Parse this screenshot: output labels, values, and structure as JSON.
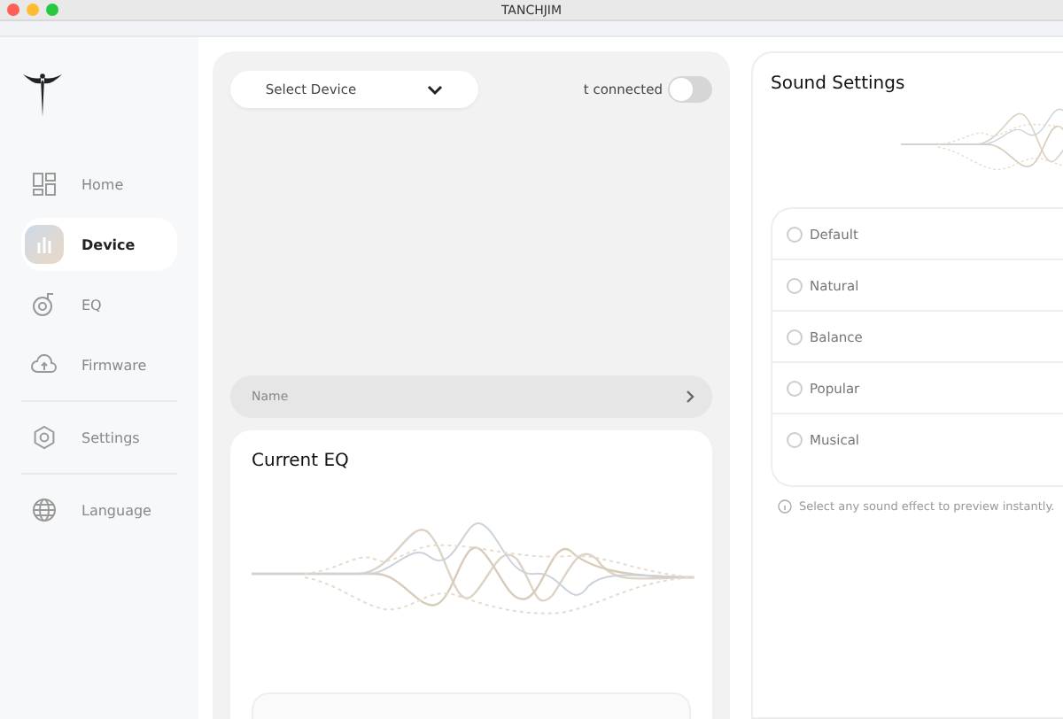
{
  "window": {
    "title": "TANCHJIM"
  },
  "sidebar": {
    "items": [
      {
        "label": "Home",
        "selected": false
      },
      {
        "label": "Device",
        "selected": true
      },
      {
        "label": "EQ",
        "selected": false
      },
      {
        "label": "Firmware",
        "selected": false
      },
      {
        "label": "Settings",
        "selected": false
      },
      {
        "label": "Language",
        "selected": false
      }
    ]
  },
  "device_panel": {
    "select": "Select Device",
    "status": "t connected",
    "connected": false,
    "name_label": "Name"
  },
  "current_eq": {
    "title": "Current EQ"
  },
  "sound_settings": {
    "title": "Sound Settings",
    "options": [
      {
        "label": "Default",
        "selected": false
      },
      {
        "label": "Natural",
        "selected": false
      },
      {
        "label": "Balance",
        "selected": false
      },
      {
        "label": "Popular",
        "selected": false
      },
      {
        "label": "Musical",
        "selected": false
      }
    ],
    "hint": "Select any sound effect to preview instantly."
  }
}
